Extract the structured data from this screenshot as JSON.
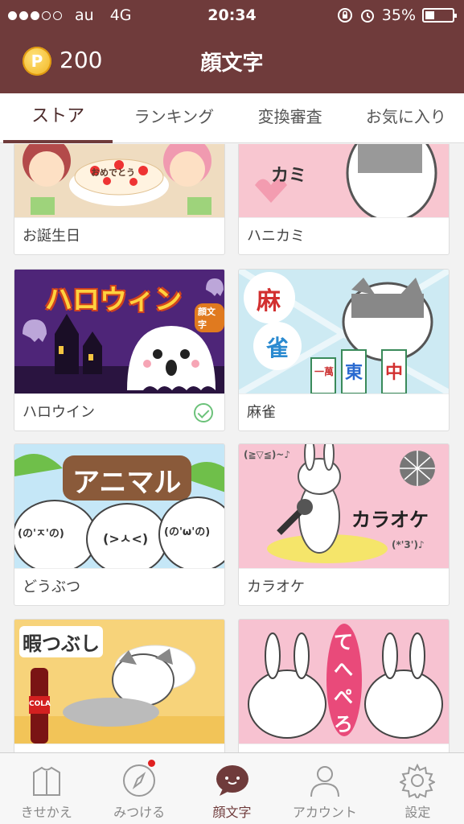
{
  "status": {
    "carrier": "au",
    "network": "4G",
    "time": "20:34",
    "battery": "35%",
    "battery_level": 0.35,
    "signal_bars": 3
  },
  "header": {
    "coins": "200",
    "coin_symbol": "P",
    "title": "顔文字"
  },
  "tabs": [
    {
      "label": "ストア",
      "active": true
    },
    {
      "label": "ランキング",
      "active": false
    },
    {
      "label": "変換審査",
      "active": false
    },
    {
      "label": "お気に入り",
      "active": false
    }
  ],
  "cards": [
    {
      "label": "お誕生日",
      "art": {
        "text": "おめでとう"
      }
    },
    {
      "label": "ハニカミ",
      "art": {
        "text": "カミ"
      }
    },
    {
      "label": "ハロウイン",
      "owned": true,
      "art": {
        "text": "ハロウィン",
        "sub": "顔文字"
      }
    },
    {
      "label": "麻雀",
      "art": {
        "text1": "麻",
        "text2": "雀",
        "tile1": "一萬",
        "tile2": "東",
        "tile3": "中"
      }
    },
    {
      "label": "どうぶつ",
      "art": {
        "text": "アニマル",
        "face1": "(の'ㅈ'の)",
        "face2": "(>ㅅ<)",
        "face3": "(の'ω'の)"
      }
    },
    {
      "label": "カラオケ",
      "art": {
        "text": "カラオケ",
        "face1": "(≧▽≦)~♪",
        "face2": "(*'3')♪"
      }
    },
    {
      "label": "",
      "art": {
        "text": "暇つぶし",
        "brand": "COLA"
      }
    },
    {
      "label": "",
      "art": {
        "text1": "て",
        "text2": "へ",
        "text3": "ぺ",
        "text4": "ろ"
      }
    }
  ],
  "bottomnav": [
    {
      "label": "きせかえ",
      "icon": "shirt-icon",
      "active": false
    },
    {
      "label": "みつける",
      "icon": "compass-icon",
      "active": false,
      "badge": true
    },
    {
      "label": "顔文字",
      "icon": "kaomoji-bubble-icon",
      "active": true
    },
    {
      "label": "アカウント",
      "icon": "person-icon",
      "active": false
    },
    {
      "label": "設定",
      "icon": "gear-icon",
      "active": false
    }
  ],
  "colors": {
    "brand": "#6f3b3b",
    "accent_check": "#6cc27a",
    "badge": "#e02020"
  }
}
